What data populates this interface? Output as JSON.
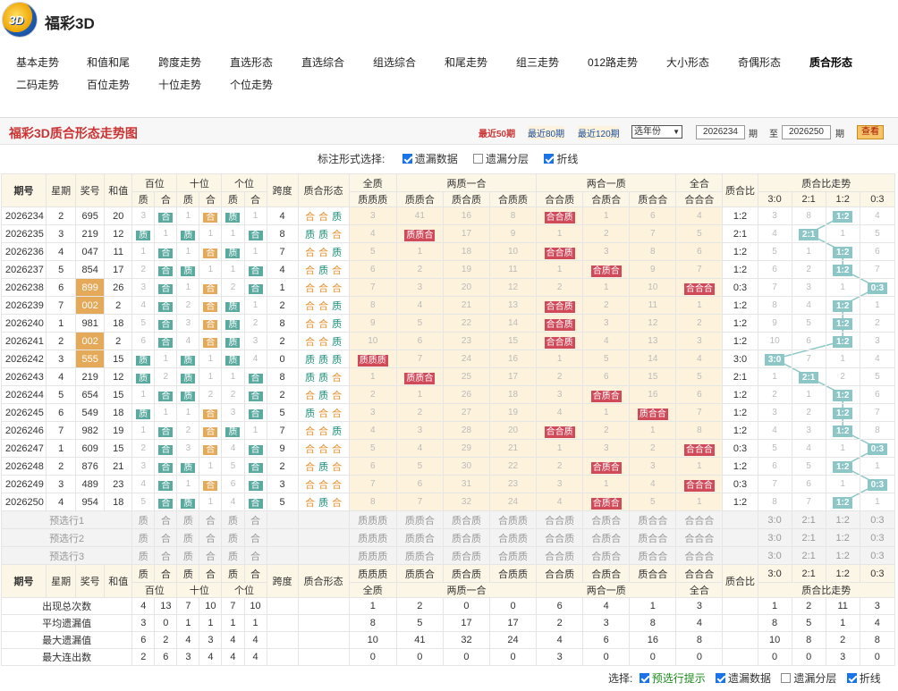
{
  "app": {
    "brand": "福彩3D",
    "logo_text": "3D"
  },
  "nav_row1": [
    "基本走势",
    "和值和尾",
    "跨度走势",
    "直选形态",
    "直选综合",
    "组选综合",
    "和尾走势",
    "组三走势",
    "012路走势",
    "大小形态",
    "奇偶形态",
    "质合形态"
  ],
  "nav_row2": [
    "二码走势",
    "百位走势",
    "十位走势",
    "个位走势"
  ],
  "panel": {
    "title": "福彩3D质合形态走势图",
    "recent50": "最近50期",
    "recent80": "最近80期",
    "recent120": "最近120期",
    "year_select": "选年份",
    "from": "2026234",
    "to": "2026250",
    "qi": "期",
    "zhi": "至",
    "view": "查看"
  },
  "mark_opts": {
    "label": "标注形式选择:",
    "opt1": "遗漏数据",
    "opt2": "遗漏分层",
    "opt3": "折线"
  },
  "headers": {
    "qihao": "期号",
    "xingqi": "星期",
    "jianghao": "奖号",
    "hezhi": "和值",
    "bai": "百位",
    "shi": "十位",
    "ge": "个位",
    "z": "质",
    "h": "合",
    "kuadu": "跨度",
    "zhxt": "质合形态",
    "quanzhi": "全质",
    "liangzhi": "两质一合",
    "lianghe": "两合一质",
    "quanhe": "全合",
    "zhb": "质合比",
    "zhbzs": "质合比走势",
    "g1": [
      "质质质"
    ],
    "g2": [
      "质质合",
      "质合质",
      "合质质"
    ],
    "g3": [
      "合合质",
      "合质合",
      "质合合"
    ],
    "g4": [
      "合合合"
    ],
    "ratios": [
      "3:0",
      "2:1",
      "1:2",
      "0:3"
    ]
  },
  "rows": [
    {
      "q": "2026234",
      "w": "2",
      "n": "695",
      "s": "20",
      "bai": [
        "3",
        "合"
      ],
      "shi": [
        "1",
        "合"
      ],
      "ge": [
        "质",
        "1"
      ],
      "k": "4",
      "f": [
        "合",
        "合",
        "质"
      ],
      "c": [
        "3",
        "41",
        "16",
        "8",
        "合合质",
        "1",
        "6",
        "4"
      ],
      "r": "1:2",
      "rr": [
        "3",
        "8",
        "1:2",
        "4"
      ]
    },
    {
      "q": "2026235",
      "w": "3",
      "n": "219",
      "s": "12",
      "bai": [
        "质",
        "1"
      ],
      "shi": [
        "质",
        "1"
      ],
      "ge": [
        "1",
        "合"
      ],
      "k": "8",
      "f": [
        "质",
        "质",
        "合"
      ],
      "c": [
        "4",
        "质质合",
        "17",
        "9",
        "1",
        "2",
        "7",
        "5"
      ],
      "r": "2:1",
      "rr": [
        "4",
        "2:1",
        "1",
        "5"
      ]
    },
    {
      "q": "2026236",
      "w": "4",
      "n": "047",
      "s": "11",
      "bai": [
        "1",
        "合"
      ],
      "shi": [
        "1",
        "合"
      ],
      "ge": [
        "质",
        "1"
      ],
      "k": "7",
      "f": [
        "合",
        "合",
        "质"
      ],
      "c": [
        "5",
        "1",
        "18",
        "10",
        "合合质",
        "3",
        "8",
        "6"
      ],
      "r": "1:2",
      "rr": [
        "5",
        "1",
        "1:2",
        "6"
      ]
    },
    {
      "q": "2026237",
      "w": "5",
      "n": "854",
      "s": "17",
      "bai": [
        "2",
        "合"
      ],
      "shi": [
        "质",
        "1"
      ],
      "ge": [
        "1",
        "合"
      ],
      "k": "4",
      "f": [
        "合",
        "质",
        "合"
      ],
      "c": [
        "6",
        "2",
        "19",
        "11",
        "1",
        "合质合",
        "9",
        "7"
      ],
      "r": "1:2",
      "rr": [
        "6",
        "2",
        "1:2",
        "7"
      ]
    },
    {
      "q": "2026238",
      "w": "6",
      "n": "899",
      "s": "26",
      "bai": [
        "3",
        "合"
      ],
      "shi": [
        "1",
        "合"
      ],
      "ge": [
        "2",
        "合"
      ],
      "k": "1",
      "f": [
        "合",
        "合",
        "合"
      ],
      "c": [
        "7",
        "3",
        "20",
        "12",
        "2",
        "1",
        "10",
        "合合合"
      ],
      "r": "0:3",
      "rr": [
        "7",
        "3",
        "1",
        "0:3"
      ]
    },
    {
      "q": "2026239",
      "w": "7",
      "n": "002",
      "s": "2",
      "bai": [
        "4",
        "合"
      ],
      "shi": [
        "2",
        "合"
      ],
      "ge": [
        "质",
        "1"
      ],
      "k": "2",
      "f": [
        "合",
        "合",
        "质"
      ],
      "c": [
        "8",
        "4",
        "21",
        "13",
        "合合质",
        "2",
        "11",
        "1"
      ],
      "r": "1:2",
      "rr": [
        "8",
        "4",
        "1:2",
        "1"
      ]
    },
    {
      "q": "2026240",
      "w": "1",
      "n": "981",
      "s": "18",
      "bai": [
        "5",
        "合"
      ],
      "shi": [
        "3",
        "合"
      ],
      "ge": [
        "质",
        "2"
      ],
      "k": "8",
      "f": [
        "合",
        "合",
        "质"
      ],
      "c": [
        "9",
        "5",
        "22",
        "14",
        "合合质",
        "3",
        "12",
        "2"
      ],
      "r": "1:2",
      "rr": [
        "9",
        "5",
        "1:2",
        "2"
      ]
    },
    {
      "q": "2026241",
      "w": "2",
      "n": "002",
      "s": "2",
      "bai": [
        "6",
        "合"
      ],
      "shi": [
        "4",
        "合"
      ],
      "ge": [
        "质",
        "3"
      ],
      "k": "2",
      "f": [
        "合",
        "合",
        "质"
      ],
      "c": [
        "10",
        "6",
        "23",
        "15",
        "合合质",
        "4",
        "13",
        "3"
      ],
      "r": "1:2",
      "rr": [
        "10",
        "6",
        "1:2",
        "3"
      ]
    },
    {
      "q": "2026242",
      "w": "3",
      "n": "555",
      "s": "15",
      "bai": [
        "质",
        "1"
      ],
      "shi": [
        "质",
        "1"
      ],
      "ge": [
        "质",
        "4"
      ],
      "k": "0",
      "f": [
        "质",
        "质",
        "质"
      ],
      "c": [
        "质质质",
        "7",
        "24",
        "16",
        "1",
        "5",
        "14",
        "4"
      ],
      "r": "3:0",
      "rr": [
        "3:0",
        "7",
        "1",
        "4"
      ]
    },
    {
      "q": "2026243",
      "w": "4",
      "n": "219",
      "s": "12",
      "bai": [
        "质",
        "2"
      ],
      "shi": [
        "质",
        "1"
      ],
      "ge": [
        "1",
        "合"
      ],
      "k": "8",
      "f": [
        "质",
        "质",
        "合"
      ],
      "c": [
        "1",
        "质质合",
        "25",
        "17",
        "2",
        "6",
        "15",
        "5"
      ],
      "r": "2:1",
      "rr": [
        "1",
        "2:1",
        "2",
        "5"
      ]
    },
    {
      "q": "2026244",
      "w": "5",
      "n": "654",
      "s": "15",
      "bai": [
        "1",
        "合"
      ],
      "shi": [
        "质",
        "2"
      ],
      "ge": [
        "2",
        "合"
      ],
      "k": "2",
      "f": [
        "合",
        "质",
        "合"
      ],
      "c": [
        "2",
        "1",
        "26",
        "18",
        "3",
        "合质合",
        "16",
        "6"
      ],
      "r": "1:2",
      "rr": [
        "2",
        "1",
        "1:2",
        "6"
      ]
    },
    {
      "q": "2026245",
      "w": "6",
      "n": "549",
      "s": "18",
      "bai": [
        "质",
        "1"
      ],
      "shi": [
        "1",
        "合"
      ],
      "ge": [
        "3",
        "合"
      ],
      "k": "5",
      "f": [
        "质",
        "合",
        "合"
      ],
      "c": [
        "3",
        "2",
        "27",
        "19",
        "4",
        "1",
        "质合合",
        "7"
      ],
      "r": "1:2",
      "rr": [
        "3",
        "2",
        "1:2",
        "7"
      ]
    },
    {
      "q": "2026246",
      "w": "7",
      "n": "982",
      "s": "19",
      "bai": [
        "1",
        "合"
      ],
      "shi": [
        "2",
        "合"
      ],
      "ge": [
        "质",
        "1"
      ],
      "k": "7",
      "f": [
        "合",
        "合",
        "质"
      ],
      "c": [
        "4",
        "3",
        "28",
        "20",
        "合合质",
        "2",
        "1",
        "8"
      ],
      "r": "1:2",
      "rr": [
        "4",
        "3",
        "1:2",
        "8"
      ]
    },
    {
      "q": "2026247",
      "w": "1",
      "n": "609",
      "s": "15",
      "bai": [
        "2",
        "合"
      ],
      "shi": [
        "3",
        "合"
      ],
      "ge": [
        "4",
        "合"
      ],
      "k": "9",
      "f": [
        "合",
        "合",
        "合"
      ],
      "c": [
        "5",
        "4",
        "29",
        "21",
        "1",
        "3",
        "2",
        "合合合"
      ],
      "r": "0:3",
      "rr": [
        "5",
        "4",
        "1",
        "0:3"
      ]
    },
    {
      "q": "2026248",
      "w": "2",
      "n": "876",
      "s": "21",
      "bai": [
        "3",
        "合"
      ],
      "shi": [
        "质",
        "1"
      ],
      "ge": [
        "5",
        "合"
      ],
      "k": "2",
      "f": [
        "合",
        "质",
        "合"
      ],
      "c": [
        "6",
        "5",
        "30",
        "22",
        "2",
        "合质合",
        "3",
        "1"
      ],
      "r": "1:2",
      "rr": [
        "6",
        "5",
        "1:2",
        "1"
      ]
    },
    {
      "q": "2026249",
      "w": "3",
      "n": "489",
      "s": "23",
      "bai": [
        "4",
        "合"
      ],
      "shi": [
        "1",
        "合"
      ],
      "ge": [
        "6",
        "合"
      ],
      "k": "3",
      "f": [
        "合",
        "合",
        "合"
      ],
      "c": [
        "7",
        "6",
        "31",
        "23",
        "3",
        "1",
        "4",
        "合合合"
      ],
      "r": "0:3",
      "rr": [
        "7",
        "6",
        "1",
        "0:3"
      ]
    },
    {
      "q": "2026250",
      "w": "4",
      "n": "954",
      "s": "18",
      "bai": [
        "5",
        "合"
      ],
      "shi": [
        "质",
        "1"
      ],
      "ge": [
        "4",
        "合"
      ],
      "k": "5",
      "f": [
        "合",
        "质",
        "合"
      ],
      "c": [
        "8",
        "7",
        "32",
        "24",
        "4",
        "合质合",
        "5",
        "1"
      ],
      "r": "1:2",
      "rr": [
        "8",
        "7",
        "1:2",
        "1"
      ]
    }
  ],
  "pre_rows": [
    "预选行1",
    "预选行2",
    "预选行3"
  ],
  "stats": [
    {
      "label": "出现总次数",
      "v": [
        "4",
        "13",
        "7",
        "10",
        "7",
        "10",
        "",
        "",
        "1",
        "2",
        "0",
        "0",
        "6",
        "4",
        "1",
        "3",
        "",
        "1",
        "2",
        "11",
        "3"
      ]
    },
    {
      "label": "平均遗漏值",
      "v": [
        "3",
        "0",
        "1",
        "1",
        "1",
        "1",
        "",
        "",
        "8",
        "5",
        "17",
        "17",
        "2",
        "3",
        "8",
        "4",
        "",
        "8",
        "5",
        "1",
        "4"
      ]
    },
    {
      "label": "最大遗漏值",
      "v": [
        "6",
        "2",
        "4",
        "3",
        "4",
        "4",
        "",
        "",
        "10",
        "41",
        "32",
        "24",
        "4",
        "6",
        "16",
        "8",
        "",
        "10",
        "8",
        "2",
        "8"
      ]
    },
    {
      "label": "最大连出数",
      "v": [
        "2",
        "6",
        "3",
        "4",
        "4",
        "4",
        "",
        "",
        "0",
        "0",
        "0",
        "0",
        "3",
        "0",
        "0",
        "0",
        "",
        "0",
        "0",
        "3",
        "0"
      ]
    }
  ],
  "footer": {
    "label": "选择:",
    "o1": "预选行提示",
    "o2": "遗漏数据",
    "o3": "遗漏分层",
    "o4": "折线"
  }
}
